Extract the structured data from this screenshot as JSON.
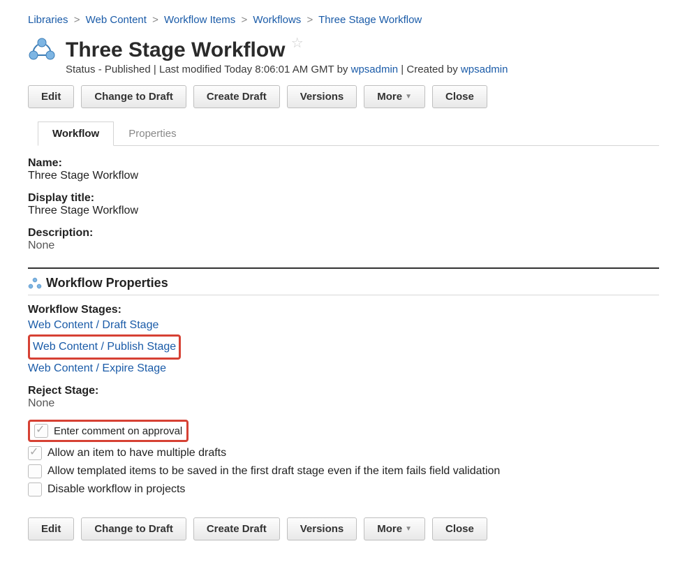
{
  "breadcrumb": [
    {
      "label": "Libraries"
    },
    {
      "label": "Web Content"
    },
    {
      "label": "Workflow Items"
    },
    {
      "label": "Workflows"
    },
    {
      "label": "Three Stage Workflow"
    }
  ],
  "header": {
    "title": "Three Stage Workflow",
    "status_prefix": "Status - ",
    "status": "Published",
    "modified_prefix": " | Last modified ",
    "modified": "Today 8:06:01 AM GMT",
    "by_label": " by ",
    "modifier": "wpsadmin",
    "created_prefix": " | Created by ",
    "creator": "wpsadmin"
  },
  "toolbar": {
    "edit": "Edit",
    "change_draft": "Change to Draft",
    "create_draft": "Create Draft",
    "versions": "Versions",
    "more": "More",
    "close": "Close"
  },
  "tabs": {
    "workflow": "Workflow",
    "properties": "Properties"
  },
  "fields": {
    "name_label": "Name:",
    "name_value": "Three Stage Workflow",
    "title_label": "Display title:",
    "title_value": "Three Stage Workflow",
    "desc_label": "Description:",
    "desc_value": "None"
  },
  "section": {
    "title": "Workflow Properties",
    "stages_label": "Workflow Stages:",
    "stages": {
      "draft": "Web Content / Draft Stage",
      "publish": "Web Content / Publish Stage",
      "expire": "Web Content / Expire Stage"
    },
    "reject_label": "Reject Stage:",
    "reject_value": "None",
    "checks": {
      "comment": "Enter comment on approval",
      "multi_drafts": "Allow an item to have multiple drafts",
      "templated": "Allow templated items to be saved in the first draft stage even if the item fails field validation",
      "disable": "Disable workflow in projects"
    }
  }
}
